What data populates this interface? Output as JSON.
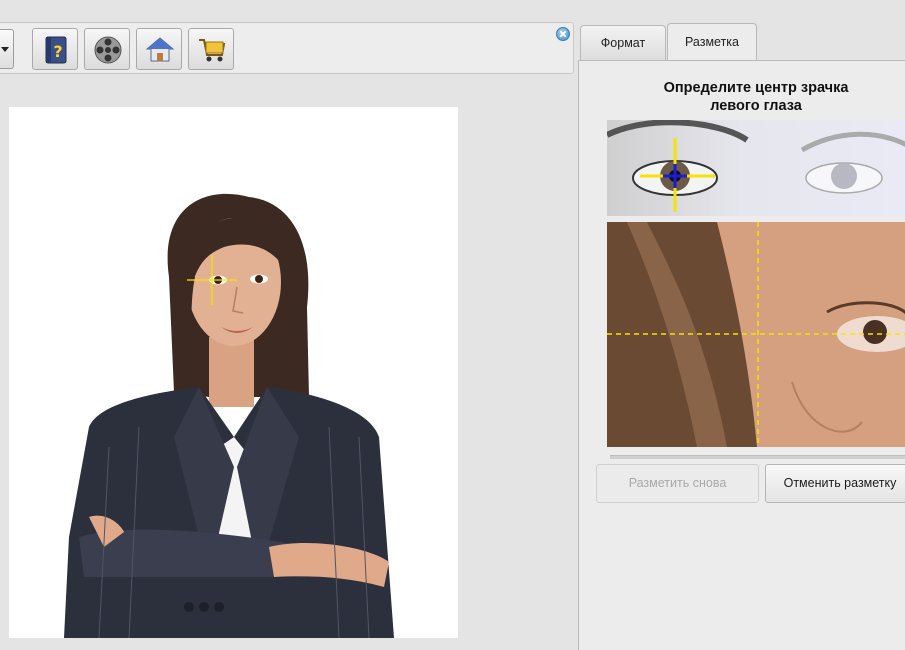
{
  "toolbar": {
    "buttons": [
      {
        "name": "help-book-button",
        "icon": "help-book-icon"
      },
      {
        "name": "video-reel-button",
        "icon": "film-reel-icon"
      },
      {
        "name": "home-button",
        "icon": "house-icon"
      },
      {
        "name": "cart-button",
        "icon": "shopping-cart-icon"
      }
    ],
    "close_icon": "close-icon",
    "accent": "#3f8ccd"
  },
  "tabs": [
    {
      "label": "Формат",
      "active": false
    },
    {
      "label": "Разметка",
      "active": true
    }
  ],
  "markup_panel": {
    "instruction": "Определите центр зрачка левого глаза",
    "crosshair_color": "#f5e400",
    "center_marker_color": "#1c1cd8",
    "buttons": {
      "redo_label": "Разметить снова",
      "redo_enabled": false,
      "cancel_label": "Отменить разметку"
    }
  }
}
